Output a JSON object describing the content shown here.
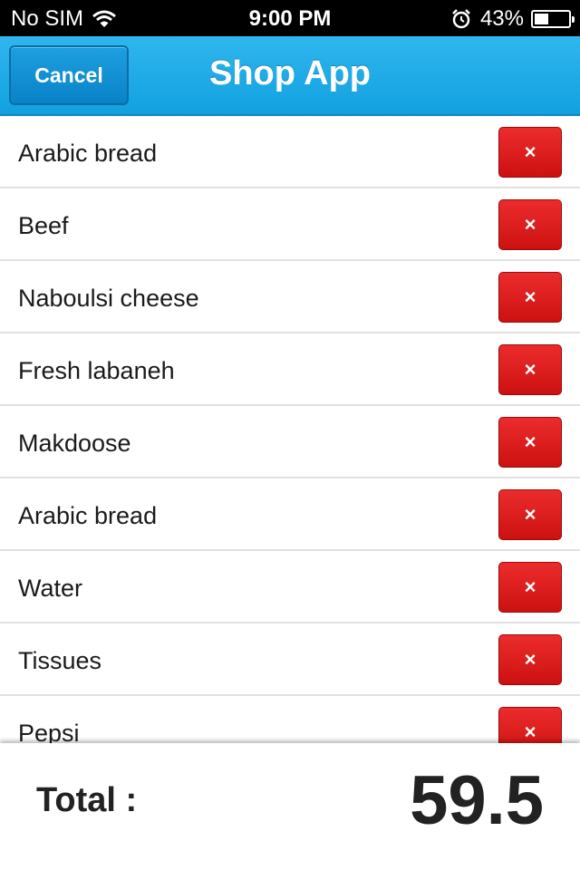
{
  "status_bar": {
    "carrier": "No SIM",
    "time": "9:00 PM",
    "battery": "43%",
    "battery_level": 0.43,
    "icons": [
      "wifi-icon",
      "alarm-icon",
      "battery-icon"
    ]
  },
  "header": {
    "cancel_label": "Cancel",
    "title": "Shop App"
  },
  "items": [
    {
      "name": "Arabic bread",
      "delete_label": "×"
    },
    {
      "name": "Beef",
      "delete_label": "×"
    },
    {
      "name": "Naboulsi cheese",
      "delete_label": "×"
    },
    {
      "name": "Fresh labaneh",
      "delete_label": "×"
    },
    {
      "name": "Makdoose",
      "delete_label": "×"
    },
    {
      "name": "Arabic bread",
      "delete_label": "×"
    },
    {
      "name": "Water",
      "delete_label": "×"
    },
    {
      "name": "Tissues",
      "delete_label": "×"
    },
    {
      "name": "Pepsi",
      "delete_label": "×"
    }
  ],
  "footer": {
    "total_label": "Total :",
    "total_value": "59.5"
  },
  "colors": {
    "header_blue": "#1aa9e6",
    "delete_red": "#e01b1b",
    "status_bar": "#000000"
  }
}
